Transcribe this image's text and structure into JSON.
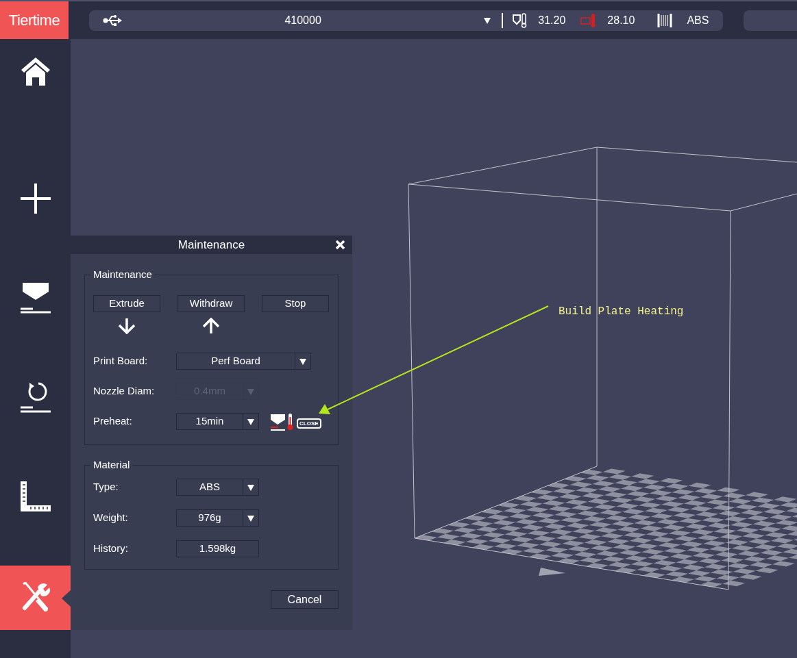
{
  "logo": "Tiertime",
  "sidebar": {
    "items": [
      {
        "kind": "home",
        "selected": false
      },
      {
        "kind": "add",
        "selected": false
      },
      {
        "kind": "print",
        "selected": false
      },
      {
        "kind": "calibrate",
        "selected": false
      },
      {
        "kind": "measure",
        "selected": false
      },
      {
        "kind": "maintenance",
        "selected": true
      }
    ]
  },
  "status_bar": {
    "printer": "410000",
    "nozzle_temp": "31.20",
    "bed_temp": "28.10",
    "material": "ABS"
  },
  "dialog": {
    "title": "Maintenance",
    "maintenance_group": {
      "legend": "Maintenance",
      "buttons": [
        "Extrude",
        "Withdraw",
        "Stop"
      ],
      "fields": [
        {
          "label": "Print Board:",
          "value": "Perf Board",
          "kind": "wide_select",
          "disabled": false
        },
        {
          "label": "Nozzle Diam:",
          "value": "0.4mm",
          "kind": "select",
          "disabled": true
        },
        {
          "label": "Preheat:",
          "value": "15min",
          "kind": "select",
          "disabled": false,
          "badge": "CLOSE"
        }
      ]
    },
    "material_group": {
      "legend": "Material",
      "fields": [
        {
          "label": "Type:",
          "value": "ABS",
          "kind": "select",
          "disabled": false
        },
        {
          "label": "Weight:",
          "value": "976g",
          "kind": "select",
          "disabled": false
        },
        {
          "label": "History:",
          "value": "1.598kg",
          "kind": "text",
          "disabled": false
        }
      ]
    },
    "cancel": "Cancel"
  },
  "annotation": "Build Plate Heating"
}
